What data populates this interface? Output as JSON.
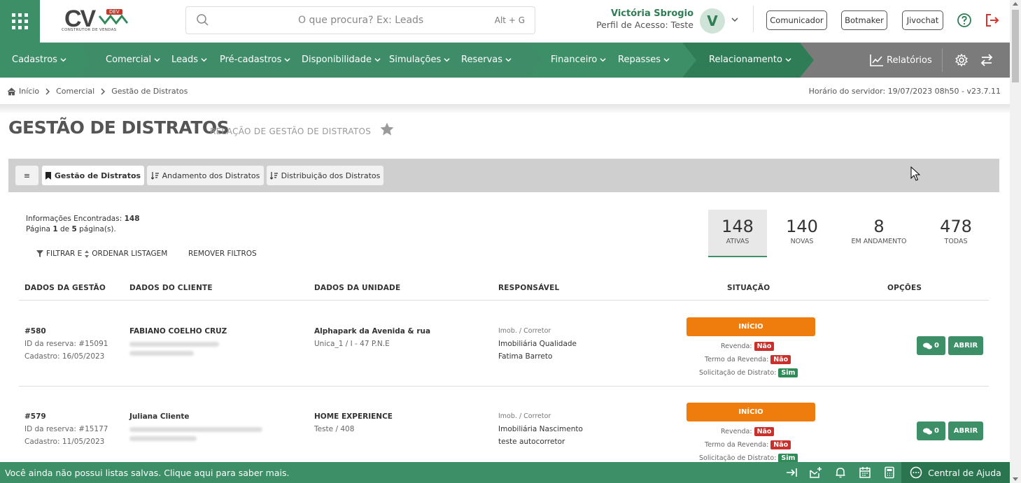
{
  "header": {
    "logo_text": "CV",
    "logo_badge": "DEV",
    "logo_subtitle": "CONSTRUTOR DE VENDAS",
    "search_placeholder": "O que procura? Ex: Leads",
    "search_shortcut": "Alt + G",
    "user_name": "Victória Sbrogio",
    "user_profile": "Perfil de Acesso: Teste",
    "avatar_initial": "V",
    "buttons": [
      "Comunicador",
      "Botmaker",
      "Jivochat"
    ]
  },
  "nav": {
    "items": [
      "Cadastros",
      "Comercial",
      "Leads",
      "Pré-cadastros",
      "Disponibilidade",
      "Simulações",
      "Reservas",
      "Financeiro",
      "Repasses",
      "Relacionamento"
    ],
    "reports": "Relatórios"
  },
  "breadcrumb": [
    "Início",
    "Comercial",
    "Gestão de Distratos"
  ],
  "server_time": "Horário do servidor: 19/07/2023 08h50 - v23.7.11",
  "page": {
    "title": "GESTÃO DE DISTRATOS",
    "subtitle": "RELAÇÃO DE GESTÃO DE DISTRATOS"
  },
  "tabs": {
    "menu": "≡",
    "items": [
      "Gestão de Distratos",
      "Andamento dos Distratos",
      "Distribuição dos Distratos"
    ]
  },
  "info": {
    "found_label": "Informações Encontradas:",
    "found_value": "148",
    "page_prefix": "Página",
    "page_current": "1",
    "page_of": "de",
    "page_total": "5",
    "page_suffix": "página(s).",
    "filter_label": "FILTRAR E",
    "order_label": "ORDENAR LISTAGEM",
    "remove_filters": "REMOVER FILTROS"
  },
  "stats": [
    {
      "num": "148",
      "label": "ATIVAS"
    },
    {
      "num": "140",
      "label": "NOVAS"
    },
    {
      "num": "8",
      "label": "EM ANDAMENTO"
    },
    {
      "num": "478",
      "label": "TODAS"
    }
  ],
  "table": {
    "headers": [
      "DADOS DA GESTÃO",
      "DADOS DO CLIENTE",
      "DADOS DA UNIDADE",
      "RESPONSÁVEL",
      "SITUAÇÃO",
      "OPÇÕES"
    ],
    "rows": [
      {
        "id": "#580",
        "reserva": "ID da reserva: #15091",
        "cadastro": "Cadastro: 16/05/2023",
        "cliente": "FABIANO COELHO CRUZ",
        "unidade": "Alphapark da Avenida & rua",
        "unidade_det": "Unica_1 / I - 47 P.N.E",
        "resp_label": "Imob. / Corretor",
        "imobiliaria": "Imobiliária Qualidade",
        "corretor": "Fatima Barreto",
        "situacao": "INÍCIO",
        "revenda_label": "Revenda:",
        "revenda": "Não",
        "termo_label": "Termo da Revenda:",
        "termo": "Não",
        "solicitacao_label": "Solicitação de Distrato:",
        "solicitacao": "Sim",
        "comments": "0",
        "open": "ABRIR"
      },
      {
        "id": "#579",
        "reserva": "ID da reserva: #15177",
        "cadastro": "Cadastro: 11/05/2023",
        "cliente": "Juliana Cliente",
        "unidade": "HOME EXPERIENCE",
        "unidade_det": "Teste / 408",
        "resp_label": "Imob. / Corretor",
        "imobiliaria": "Imobiliária Nascimento",
        "corretor": "teste autocorretor",
        "situacao": "INÍCIO",
        "revenda_label": "Revenda:",
        "revenda": "Não",
        "termo_label": "Termo da Revenda:",
        "termo": "Não",
        "solicitacao_label": "Solicitação de Distrato:",
        "solicitacao": "Sim",
        "comments": "0",
        "open": "ABRIR"
      }
    ]
  },
  "bottom": {
    "message": "Você ainda não possui listas salvas. Clique aqui para saber mais.",
    "help_center": "Central de Ajuda"
  },
  "colors": {
    "brand_green": "#3c8f66",
    "nav_gray": "#7b7b7b",
    "badge_orange": "#ee7d0e",
    "flag_red": "#c9302c",
    "flag_green": "#2e8b57"
  }
}
